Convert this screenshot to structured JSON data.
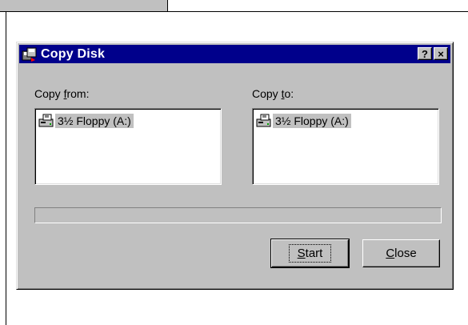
{
  "dialog": {
    "title": "Copy Disk",
    "help_button": "?",
    "close_button": "×",
    "copy_from": {
      "label_prefix": "Copy ",
      "label_accel": "f",
      "label_suffix": "rom:"
    },
    "copy_to": {
      "label_prefix": "Copy ",
      "label_accel": "t",
      "label_suffix": "o:"
    },
    "source_drives": [
      {
        "name": "3½ Floppy (A:)",
        "icon": "floppy-drive-icon"
      }
    ],
    "destination_drives": [
      {
        "name": "3½ Floppy (A:)",
        "icon": "floppy-drive-icon"
      }
    ],
    "progress": 0,
    "buttons": {
      "start": {
        "accel": "S",
        "rest": "tart"
      },
      "close": {
        "accel": "C",
        "rest": "lose"
      }
    }
  },
  "colors": {
    "titlebar": "#00008b",
    "face": "#c0c0c0",
    "selection": "#c0c0c0"
  }
}
